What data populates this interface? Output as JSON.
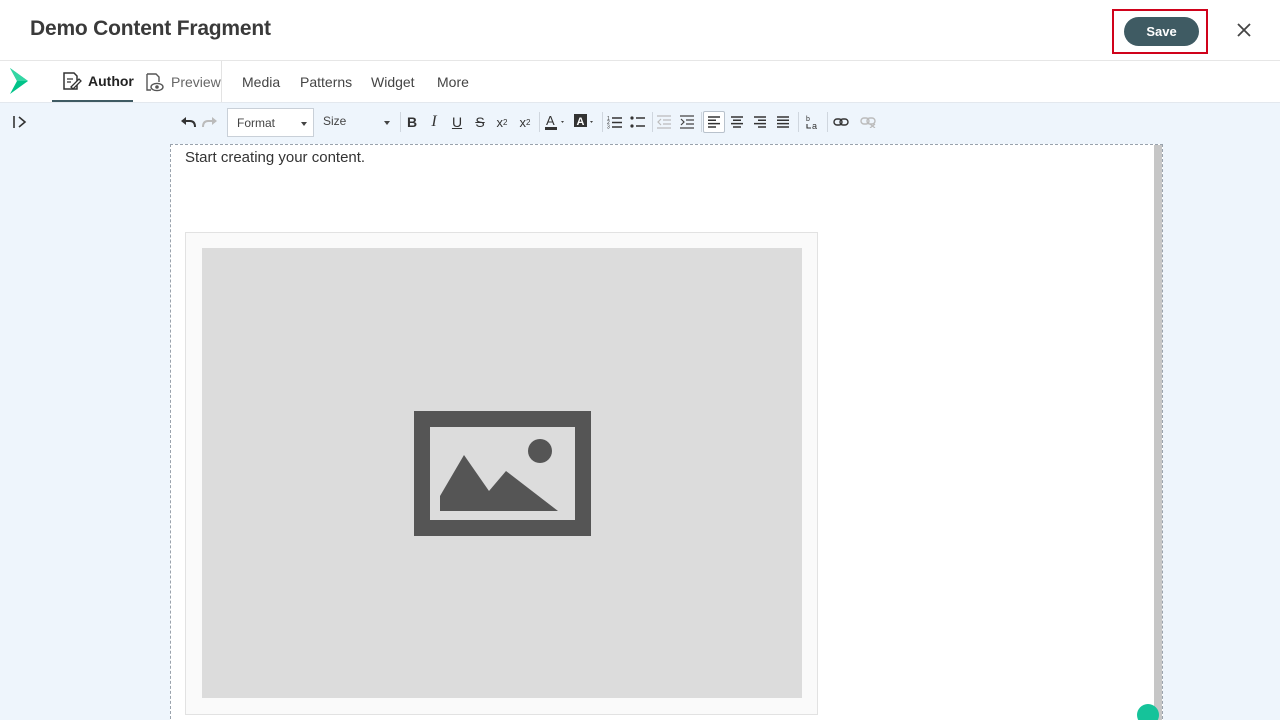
{
  "header": {
    "title": "Demo Content Fragment",
    "save_label": "Save",
    "close_icon": "close-icon"
  },
  "nav": {
    "logo_icon": "chevron-logo-icon",
    "tabs": [
      {
        "label": "Author",
        "icon": "edit-document-icon",
        "active": true
      },
      {
        "label": "Preview",
        "icon": "eye-document-icon",
        "active": false
      }
    ],
    "menu": [
      "Media",
      "Patterns",
      "Widget",
      "More"
    ]
  },
  "toolbar": {
    "format_label": "Format",
    "size_label": "Size",
    "icons": [
      "undo-icon",
      "redo-icon",
      "bold-icon",
      "italic-icon",
      "underline-icon",
      "strikethrough-icon",
      "subscript-icon",
      "superscript-icon",
      "text-color-icon",
      "background-color-icon",
      "numbered-list-icon",
      "bulleted-list-icon",
      "decrease-indent-icon",
      "increase-indent-icon",
      "align-left-icon",
      "align-center-icon",
      "align-right-icon",
      "justify-icon",
      "text-direction-icon",
      "link-icon",
      "unlink-icon"
    ]
  },
  "editor": {
    "placeholder": "Start creating your content.",
    "image_icon": "image-placeholder-icon"
  },
  "colors": {
    "accent": "#3f5b63",
    "highlight_border": "#d0021b",
    "workspace_bg": "#eef5fc",
    "logo_green": "#00c389"
  }
}
